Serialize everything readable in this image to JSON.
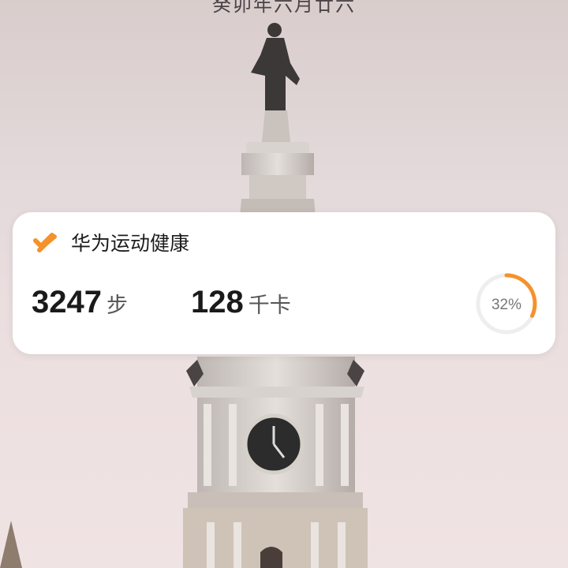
{
  "header": {
    "date_text": "癸卯年六月廿六"
  },
  "widget": {
    "app_name": "华为运动健康",
    "steps": {
      "value": "3247",
      "unit": "步"
    },
    "calories": {
      "value": "128",
      "unit": "千卡"
    },
    "progress": {
      "label": "32%",
      "percent": 32
    },
    "accent_color": "#f5922b"
  }
}
